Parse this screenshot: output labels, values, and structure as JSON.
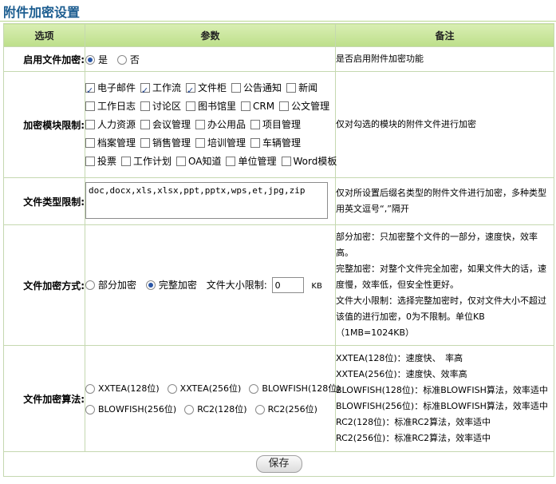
{
  "page": {
    "title": "附件加密设置"
  },
  "table": {
    "headers": {
      "option": "选项",
      "param": "参数",
      "note": "备注"
    }
  },
  "enable": {
    "label": "启用文件加密:",
    "yes": "是",
    "no": "否",
    "selected": "是",
    "note": "是否启用附件加密功能"
  },
  "modules": {
    "label": "加密模块限制:",
    "rows": [
      [
        {
          "label": "电子邮件",
          "checked": true
        },
        {
          "label": "工作流",
          "checked": true
        },
        {
          "label": "文件柜",
          "checked": true
        },
        {
          "label": "公告通知",
          "checked": false
        },
        {
          "label": "新闻",
          "checked": false
        }
      ],
      [
        {
          "label": "工作日志",
          "checked": false
        },
        {
          "label": "讨论区",
          "checked": false
        },
        {
          "label": "图书馆里",
          "checked": false
        },
        {
          "label": "CRM",
          "checked": false
        },
        {
          "label": "公文管理",
          "checked": false
        }
      ],
      [
        {
          "label": "人力资源",
          "checked": false
        },
        {
          "label": "会议管理",
          "checked": false
        },
        {
          "label": "办公用品",
          "checked": false
        },
        {
          "label": "项目管理",
          "checked": false
        }
      ],
      [
        {
          "label": "档案管理",
          "checked": false
        },
        {
          "label": "销售管理",
          "checked": false
        },
        {
          "label": "培训管理",
          "checked": false
        },
        {
          "label": "车辆管理",
          "checked": false
        }
      ],
      [
        {
          "label": "投票",
          "checked": false
        },
        {
          "label": "工作计划",
          "checked": false
        },
        {
          "label": "OA知道",
          "checked": false
        },
        {
          "label": "单位管理",
          "checked": false
        },
        {
          "label": "Word模板",
          "checked": false
        }
      ]
    ],
    "note": "仅对勾选的模块的附件文件进行加密"
  },
  "filetypes": {
    "label": "文件类型限制:",
    "value": "doc,docx,xls,xlsx,ppt,pptx,wps,et,jpg,zip",
    "note": "仅对所设置后缀名类型的附件文件进行加密，多种类型用英文逗号“,”隔开"
  },
  "mode": {
    "label": "文件加密方式:",
    "partial": "部分加密",
    "full": "完整加密",
    "selected": "完整加密",
    "size_label": "文件大小限制:",
    "size_value": "0",
    "size_unit": "KB",
    "notes": [
      "部分加密：只加密整个文件的一部分，速度快，效率高。",
      "完整加密：对整个文件完全加密，如果文件大的话，速度慢，效率低，但安全性更好。",
      "文件大小限制：选择完整加密时，仅对文件大小不超过该值的进行加密，0为不限制。单位KB（1MB=1024KB）"
    ]
  },
  "algorithm": {
    "label": "文件加密算法:",
    "options": [
      [
        "XXTEA(128位)",
        "XXTEA(256位)",
        "BLOWFISH(128位)"
      ],
      [
        "BLOWFISH(256位)",
        "RC2(128位)",
        "RC2(256位)"
      ]
    ],
    "notes": [
      "XXTEA(128位)：速度快、　率高",
      "XXTEA(256位)：速度快、效率高",
      "BLOWFISH(128位)：标准BLOWFISH算法，效率适中",
      "BLOWFISH(256位)：标准BLOWFISH算法，效率适中",
      "RC2(128位)：标准RC2算法，效率适中",
      "RC2(256位)：标准RC2算法，效率适中"
    ]
  },
  "save": {
    "label": "保存"
  }
}
